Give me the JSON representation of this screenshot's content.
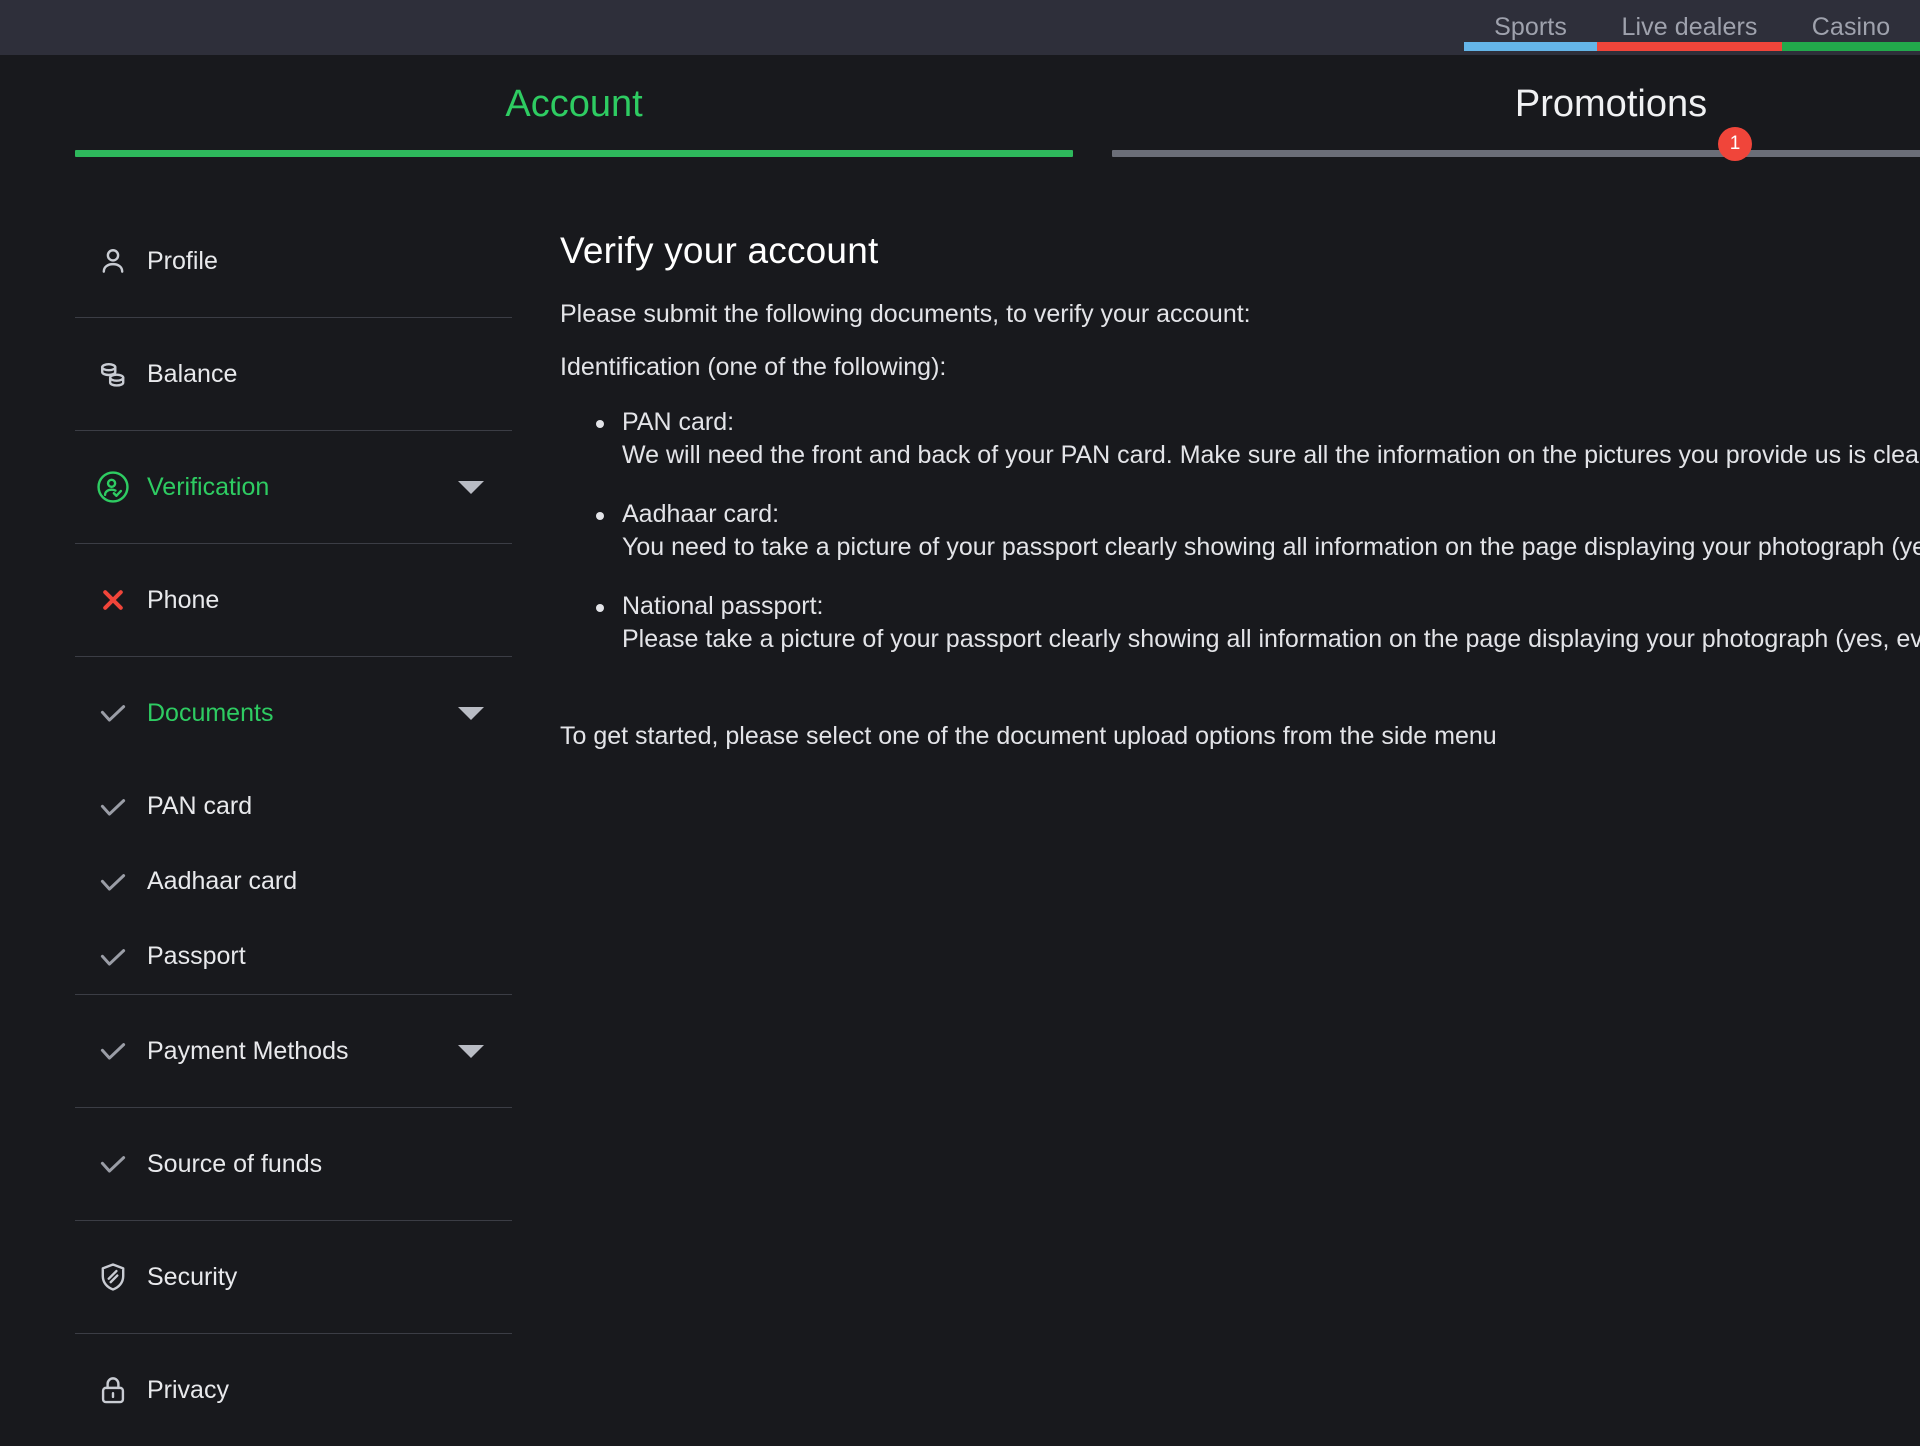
{
  "topnav": {
    "items": [
      {
        "label": "Sports",
        "accent": "#64b5e8"
      },
      {
        "label": "Live dealers",
        "accent": "#f0453a"
      },
      {
        "label": "Casino",
        "accent": "#22a94b"
      }
    ]
  },
  "tabs": {
    "account": {
      "label": "Account",
      "accent": "#2eb85c"
    },
    "promotions": {
      "label": "Promotions",
      "badge": "1",
      "accent": "#6b6e78"
    }
  },
  "sidebar": {
    "items": [
      {
        "label": "Profile",
        "icon": "user-icon",
        "state": "plain",
        "chevron": false,
        "sub": false,
        "divider": true
      },
      {
        "label": "Balance",
        "icon": "coins-icon",
        "state": "plain",
        "chevron": false,
        "sub": false,
        "divider": true
      },
      {
        "label": "Verification",
        "icon": "user-verified-icon",
        "state": "active",
        "chevron": true,
        "sub": false,
        "divider": true
      },
      {
        "label": "Phone",
        "icon": "cross-icon",
        "state": "error",
        "chevron": false,
        "sub": false,
        "divider": true
      },
      {
        "label": "Documents",
        "icon": "check-icon",
        "state": "active",
        "chevron": true,
        "sub": false,
        "divider": false
      },
      {
        "label": "PAN card",
        "icon": "check-icon",
        "state": "plain",
        "chevron": false,
        "sub": true,
        "divider": false
      },
      {
        "label": "Aadhaar card",
        "icon": "check-icon",
        "state": "plain",
        "chevron": false,
        "sub": true,
        "divider": false
      },
      {
        "label": "Passport",
        "icon": "check-icon",
        "state": "plain",
        "chevron": false,
        "sub": true,
        "divider": true
      },
      {
        "label": "Payment Methods",
        "icon": "check-icon",
        "state": "plain",
        "chevron": true,
        "sub": false,
        "divider": true
      },
      {
        "label": "Source of funds",
        "icon": "check-icon",
        "state": "plain",
        "chevron": false,
        "sub": false,
        "divider": true
      },
      {
        "label": "Security",
        "icon": "shield-icon",
        "state": "plain",
        "chevron": false,
        "sub": false,
        "divider": true
      },
      {
        "label": "Privacy",
        "icon": "lock-icon",
        "state": "plain",
        "chevron": false,
        "sub": false,
        "divider": false
      }
    ]
  },
  "main": {
    "title": "Verify your account",
    "intro": "Please submit the following documents, to verify your account:",
    "section_label": "Identification (one of the following):",
    "documents": [
      {
        "term": "PAN card:",
        "desc": "We will need the front and back of your PAN card. Make sure all the information on the pictures you provide us is clearly"
      },
      {
        "term": "Aadhaar card:",
        "desc": "You need to take a picture of your passport clearly showing all information on the page displaying your photograph (yes,"
      },
      {
        "term": "National passport:",
        "desc": "Please take a picture of your passport clearly showing all information on the page displaying your photograph (yes, even"
      }
    ],
    "footer_note": "To get started, please select one of the document upload options from the side menu"
  }
}
